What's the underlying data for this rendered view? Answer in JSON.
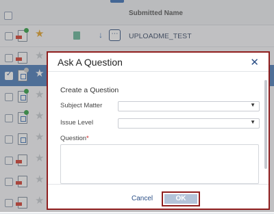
{
  "list": {
    "header": {
      "name_column": "Submitted Name"
    },
    "rows": [
      {
        "name": "UPLOADME_TEST"
      }
    ]
  },
  "modal": {
    "title": "Ask A Question",
    "close_icon": "close-icon",
    "section_title": "Create a Question",
    "subject_matter_label": "Subject Matter",
    "subject_matter_value": "",
    "issue_level_label": "Issue Level",
    "issue_level_value": "",
    "question_label": "Question",
    "required_marker": "*",
    "question_value": "",
    "cancel_label": "Cancel",
    "ok_label": "OK"
  },
  "colors": {
    "accent": "#2b4f86",
    "highlight_border": "#8f1d1d",
    "selected_row": "#4b7bb8",
    "ok_disabled": "#b3c3d9"
  }
}
